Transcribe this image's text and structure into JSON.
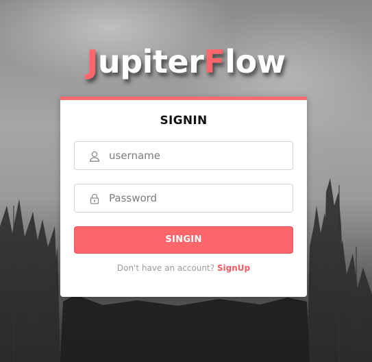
{
  "logo": {
    "letter_1": "J",
    "part_1": "upiter",
    "letter_2": "F",
    "part_2": "low",
    "accent_color": "#ff666b"
  },
  "card": {
    "title": "SIGNIN",
    "accent_color": "#ff6b6f"
  },
  "form": {
    "username": {
      "placeholder": "username",
      "value": "",
      "icon": "user-icon"
    },
    "password": {
      "placeholder": "Password",
      "value": "",
      "icon": "lock-icon"
    },
    "submit_label": "SINGIN"
  },
  "signup": {
    "prompt": "Don't have an account?",
    "link_label": "SignUp"
  }
}
